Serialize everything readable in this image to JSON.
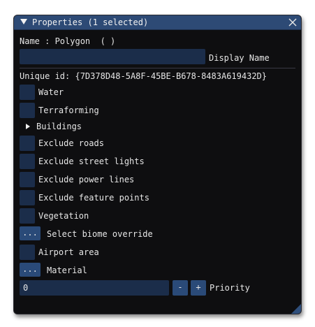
{
  "window": {
    "title": "Properties (1 selected)",
    "name_line": "Name : Polygon  ( )",
    "display_name_label": "Display Name",
    "display_name_value": "",
    "unique_id": "Unique id: {7D378D48-5A8F-45BE-B678-8483A619432D}",
    "items": [
      {
        "label": "Water"
      },
      {
        "label": "Terraforming"
      }
    ],
    "buildings_label": "Buildings",
    "items2": [
      {
        "label": "Exclude roads"
      },
      {
        "label": "Exclude street lights"
      },
      {
        "label": "Exclude power lines"
      },
      {
        "label": "Exclude feature points"
      },
      {
        "label": "Vegetation"
      }
    ],
    "biome": {
      "button": "...",
      "label": "Select biome override"
    },
    "airport_label": "Airport area",
    "material": {
      "button": "...",
      "label": "Material"
    },
    "priority": {
      "value": "0",
      "minus": "-",
      "plus": "+",
      "label": "Priority"
    }
  },
  "colors": {
    "titlebar": "#2d4a75",
    "frame_bg": "#1b2d4a",
    "button_bg": "#2a4a78",
    "window_bg": "#0e0e10"
  }
}
